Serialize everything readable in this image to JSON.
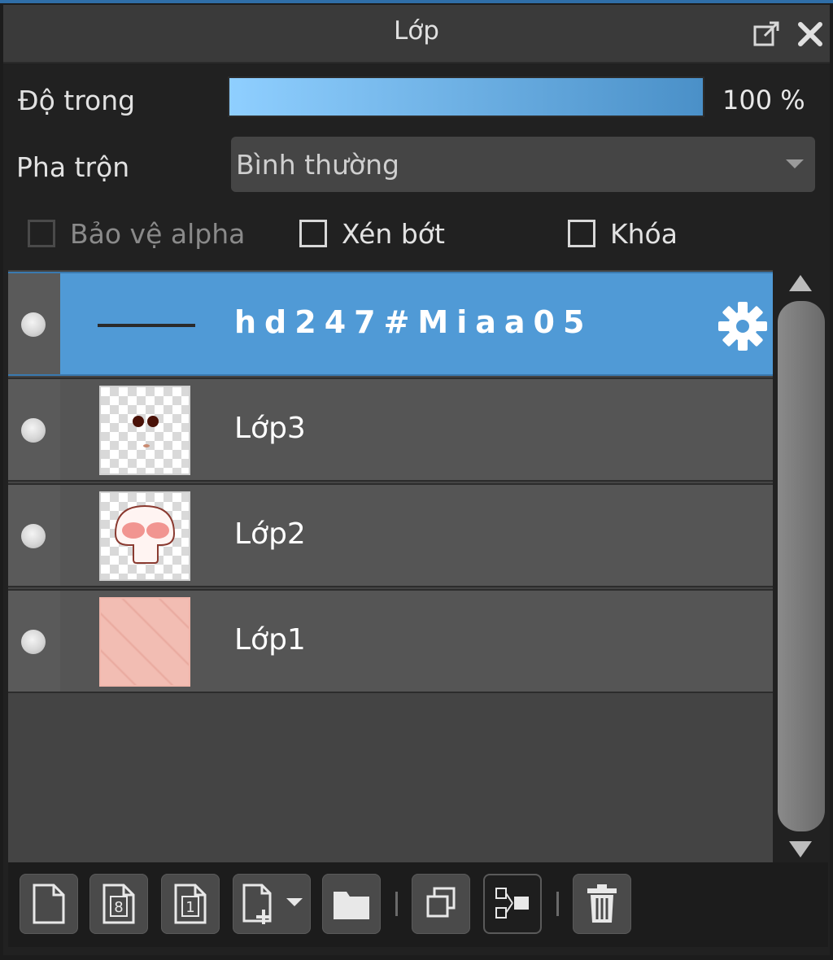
{
  "panel": {
    "title": "Lớp"
  },
  "opacity": {
    "label": "Độ trong",
    "value_text": "100 %",
    "value": 100
  },
  "blend": {
    "label": "Pha trộn",
    "selected": "Bình thường"
  },
  "checkboxes": {
    "protect_alpha": {
      "label": "Bảo vệ alpha",
      "checked": false,
      "enabled": false
    },
    "clipping": {
      "label": "Xén bớt",
      "checked": false,
      "enabled": true
    },
    "lock": {
      "label": "Khóa",
      "checked": false,
      "enabled": true
    }
  },
  "layers": [
    {
      "name": "hd247#Miaa05",
      "selected": true,
      "visible": true,
      "thumbnail": "line",
      "has_settings_icon": true
    },
    {
      "name": "Lớp3",
      "selected": false,
      "visible": true,
      "thumbnail": "eyes"
    },
    {
      "name": "Lớp2",
      "selected": false,
      "visible": true,
      "thumbnail": "mushroom"
    },
    {
      "name": "Lớp1",
      "selected": false,
      "visible": true,
      "thumbnail": "pink-fill"
    }
  ],
  "toolbar": {
    "buttons": [
      {
        "icon": "new-layer-icon"
      },
      {
        "icon": "new-8bit-layer-icon"
      },
      {
        "icon": "new-1bit-layer-icon"
      },
      {
        "icon": "add-layer-dropdown-icon"
      },
      {
        "icon": "folder-icon"
      },
      {
        "icon": "duplicate-layer-icon"
      },
      {
        "icon": "merge-down-icon"
      },
      {
        "icon": "trash-icon"
      }
    ]
  },
  "colors": {
    "accent": "#509ad6",
    "panel_bg": "#212121",
    "row_bg": "#555555"
  }
}
